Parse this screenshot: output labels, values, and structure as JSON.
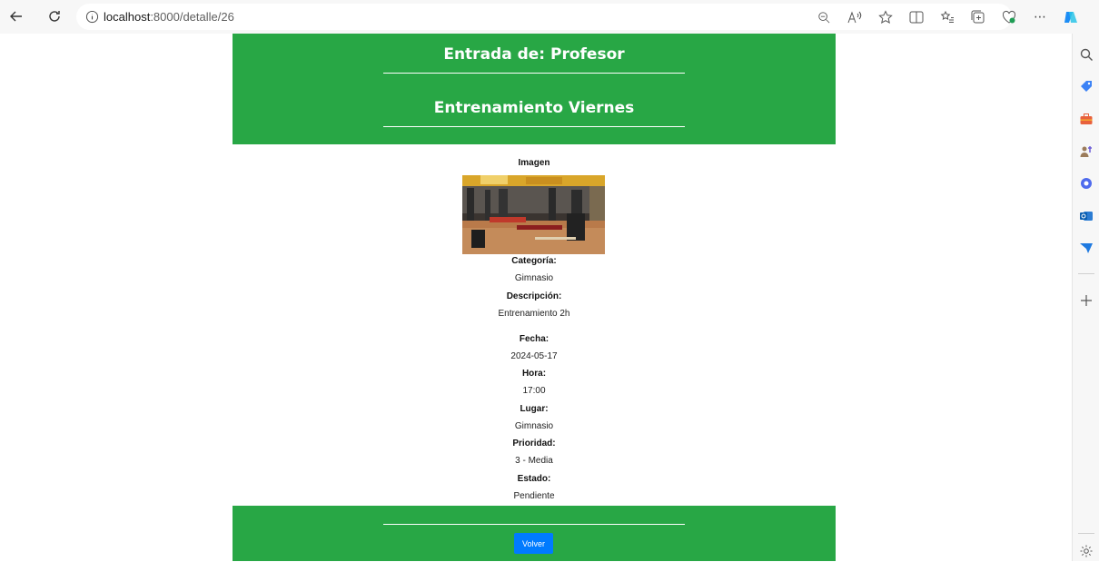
{
  "browser": {
    "url_host": "localhost",
    "url_path": ":8000/detalle/26"
  },
  "header": {
    "title": "Entrada de: Profesor",
    "subtitle": "Entrenamiento Viernes"
  },
  "details": {
    "image_label": "Imagen",
    "fields": [
      {
        "label": "Categoría:",
        "value": "Gimnasio"
      },
      {
        "label": "Descripción:",
        "value": "Entrenamiento 2h"
      },
      {
        "label": "Fecha:",
        "value": "2024-05-17"
      },
      {
        "label": "Hora:",
        "value": "17:00"
      },
      {
        "label": "Lugar:",
        "value": "Gimnasio"
      },
      {
        "label": "Prioridad:",
        "value": "3 - Media"
      },
      {
        "label": "Estado:",
        "value": "Pendiente"
      }
    ]
  },
  "footer": {
    "back_label": "Volver"
  },
  "colors": {
    "header_bg": "#28a745",
    "button_bg": "#007bff"
  }
}
